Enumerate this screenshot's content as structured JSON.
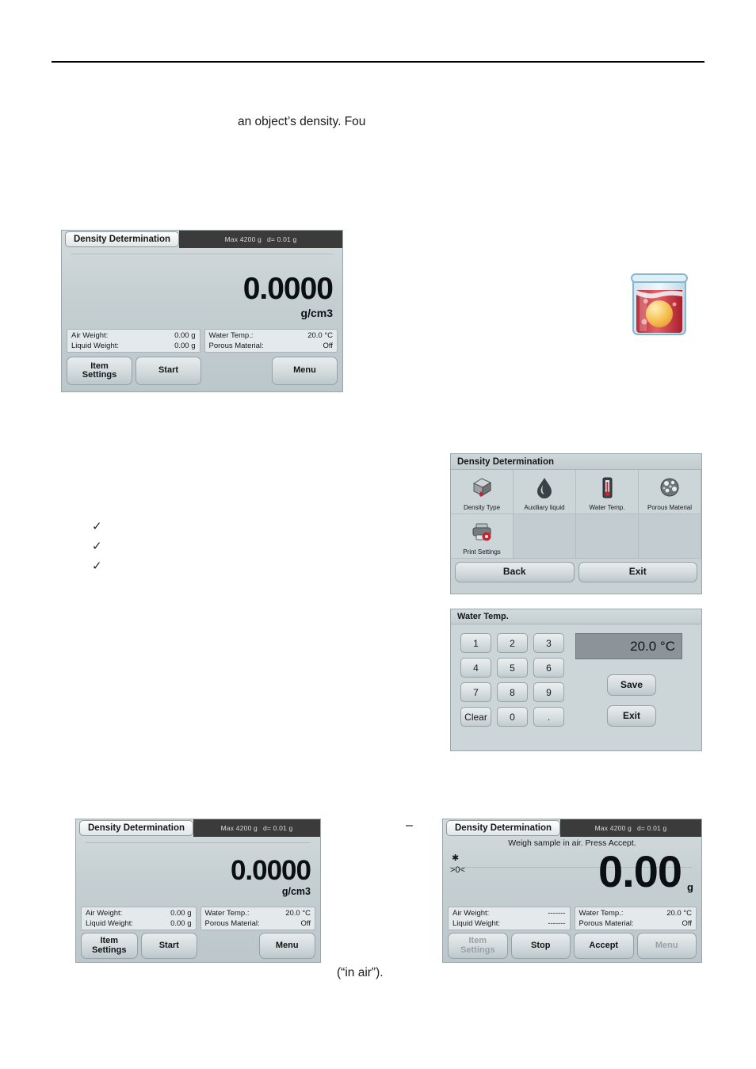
{
  "document": {
    "paragraph_fragment": "an object’s density. Fou",
    "caption_in_air": "(“in air”).",
    "dash": "–",
    "checklist": [
      "✓",
      "✓",
      "✓"
    ]
  },
  "beaker_icon": {
    "name": "density-beaker-icon"
  },
  "screen_top": {
    "title": "Density Determination",
    "capacity_max": "Max 4200 g",
    "capacity_d": "d= 0.01 g",
    "value": "0.0000",
    "unit": "g/cm3",
    "fields_left": [
      {
        "label": "Air Weight:",
        "value": "0.00 g"
      },
      {
        "label": "Liquid Weight:",
        "value": "0.00 g"
      }
    ],
    "fields_right": [
      {
        "label": "Water Temp.:",
        "value": "20.0 °C"
      },
      {
        "label": "Porous Material:",
        "value": "Off"
      }
    ],
    "buttons": [
      {
        "label": "Item\nSettings",
        "dim": false
      },
      {
        "label": "Start",
        "dim": false
      },
      {
        "label": "",
        "dim": false
      },
      {
        "label": "Menu",
        "dim": false
      }
    ]
  },
  "menu_screen": {
    "title": "Density Determination",
    "items": [
      {
        "label": "Density Type",
        "icon": "density-cube-icon"
      },
      {
        "label": "Auxiliary liquid",
        "icon": "water-drop-icon"
      },
      {
        "label": "Water Temp.",
        "icon": "thermometer-icon"
      },
      {
        "label": "Porous Material",
        "icon": "porous-sphere-icon"
      },
      {
        "label": "Print Settings",
        "icon": "printer-gear-icon"
      }
    ],
    "back_label": "Back",
    "exit_label": "Exit"
  },
  "keypad_screen": {
    "title": "Water Temp.",
    "display_value": "20.0 °C",
    "keys": [
      "1",
      "2",
      "3",
      "4",
      "5",
      "6",
      "7",
      "8",
      "9",
      "Clear",
      "0",
      "."
    ],
    "save_label": "Save",
    "exit_label": "Exit"
  },
  "screen_bottom_left": {
    "title": "Density Determination",
    "capacity_max": "Max 4200 g",
    "capacity_d": "d= 0.01 g",
    "value": "0.0000",
    "unit": "g/cm3",
    "fields_left": [
      {
        "label": "Air Weight:",
        "value": "0.00 g"
      },
      {
        "label": "Liquid Weight:",
        "value": "0.00 g"
      }
    ],
    "fields_right": [
      {
        "label": "Water Temp.:",
        "value": "20.0 °C"
      },
      {
        "label": "Porous Material:",
        "value": "Off"
      }
    ],
    "buttons": [
      {
        "label": "Item\nSettings",
        "dim": false
      },
      {
        "label": "Start",
        "dim": false
      },
      {
        "label": "",
        "dim": false
      },
      {
        "label": "Menu",
        "dim": false
      }
    ]
  },
  "screen_bottom_right": {
    "title": "Density Determination",
    "capacity_max": "Max 4200 g",
    "capacity_d": "d= 0.01 g",
    "instruction": "Weigh sample in air. Press Accept.",
    "stable_indicator": "✱",
    "zero_indicator": ">0<",
    "value": "0.00",
    "unit": "g",
    "fields_left": [
      {
        "label": "Air Weight:",
        "value": "-------"
      },
      {
        "label": "Liquid Weight:",
        "value": "-------"
      }
    ],
    "fields_right": [
      {
        "label": "Water Temp.:",
        "value": "20.0 °C"
      },
      {
        "label": "Porous Material:",
        "value": "Off"
      }
    ],
    "buttons": [
      {
        "label": "Item\nSettings",
        "dim": true
      },
      {
        "label": "Stop",
        "dim": false
      },
      {
        "label": "Accept",
        "dim": false
      },
      {
        "label": "Menu",
        "dim": true
      }
    ]
  },
  "colors": {
    "screen_bg": "#c8d1d4",
    "header_dark": "#3b3b3b",
    "keypad_display": "#8c9499",
    "accent_red": "#c0252a"
  }
}
